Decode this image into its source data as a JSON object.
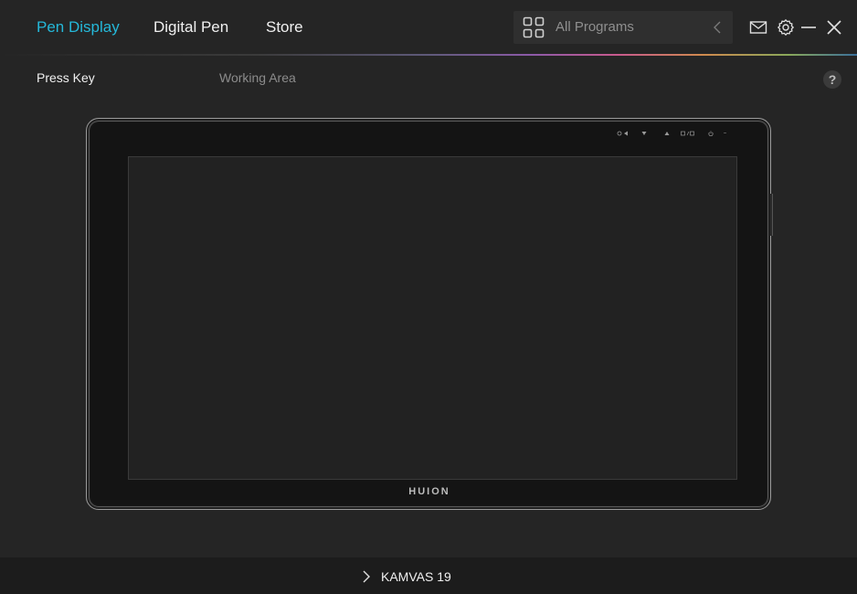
{
  "nav": {
    "tabs": [
      {
        "label": "Pen Display",
        "active": true
      },
      {
        "label": "Digital Pen",
        "active": false
      },
      {
        "label": "Store",
        "active": false
      }
    ]
  },
  "programs": {
    "label": "All Programs",
    "icon": "grid-icon"
  },
  "window_controls": [
    "mail-icon",
    "gear-icon",
    "minimize-icon",
    "close-icon"
  ],
  "subtabs": [
    {
      "label": "Press Key",
      "active": true
    },
    {
      "label": "Working Area",
      "active": false
    }
  ],
  "help": {
    "label": "?"
  },
  "device": {
    "brand": "HUION",
    "name": "KAMVAS 19"
  },
  "colors": {
    "accent": "#25b8d9",
    "background": "#252525",
    "footer": "#1c1c1c"
  }
}
